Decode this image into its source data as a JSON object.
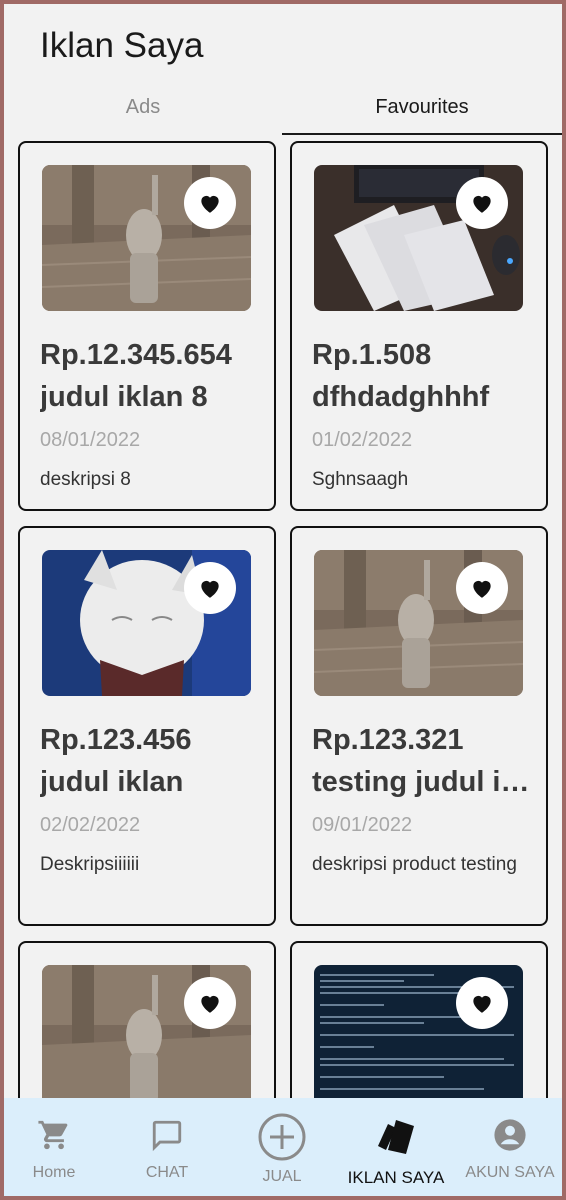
{
  "header": {
    "title": "Iklan Saya"
  },
  "tabs": [
    {
      "label": "Ads",
      "active": false
    },
    {
      "label": "Favourites",
      "active": true
    }
  ],
  "cards": [
    {
      "price": "Rp.12.345.654",
      "title": "judul iklan 8",
      "date": "08/01/2022",
      "description": "deskripsi 8",
      "image": "dog-figure",
      "favorited": true
    },
    {
      "price": "Rp.1.508",
      "title": "dfhdadghhhf",
      "date": "01/02/2022",
      "description": "Sghnsaagh",
      "image": "laptop-papers",
      "favorited": true
    },
    {
      "price": "Rp.123.456",
      "title": "judul iklan",
      "date": "02/02/2022",
      "description": "Deskripsiiiiii",
      "image": "white-cat",
      "favorited": true
    },
    {
      "price": "Rp.123.321",
      "title": "testing judul iklan",
      "date": "09/01/2022",
      "description": "deskripsi product testing",
      "image": "dog-figure",
      "favorited": true
    },
    {
      "price": "",
      "title": "",
      "date": "",
      "description": "",
      "image": "dog-figure",
      "favorited": true
    },
    {
      "price": "",
      "title": "",
      "date": "",
      "description": "",
      "image": "terminal-screen",
      "favorited": true
    }
  ],
  "bottom_nav": [
    {
      "label": "Home",
      "icon": "cart-icon",
      "active": false
    },
    {
      "label": "CHAT",
      "icon": "chat-icon",
      "active": false
    },
    {
      "label": "JUAL",
      "icon": "plus-circle-icon",
      "active": false
    },
    {
      "label": "IKLAN SAYA",
      "icon": "cards-icon",
      "active": true
    },
    {
      "label": "AKUN SAYA",
      "icon": "account-icon",
      "active": false
    }
  ],
  "colors": {
    "nav_bg": "#dbeefb",
    "card_border": "#111111",
    "price_text": "#3a3a3a",
    "date_text": "#a8a8a8"
  }
}
